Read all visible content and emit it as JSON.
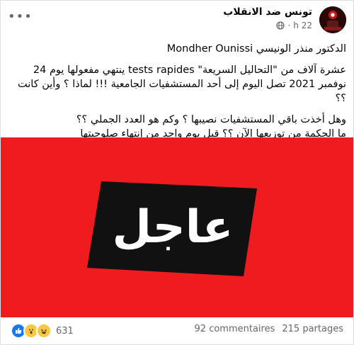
{
  "header": {
    "page_name": "تونس ضد الانقلاب",
    "time": "22 h",
    "separator": "·"
  },
  "post": {
    "author_line": "الدكتور منذر الونيسي Mondher Ounissi",
    "para1_line1": "عشرة آلاف من \"التحاليل السريعة\" tests rapides ينتهي مفعولها يوم 24",
    "para1_line2": "نوفمبر 2021 تصل اليوم إلى أحد المستشفيات الجامعية !!! لماذا ؟ وأين كانت",
    "para1_line3": "؟؟",
    "para2_line1": "وهل أخذت باقي المستشفيات نصيبها ؟ وكم هو العدد الجملي ؟؟",
    "para2_line2": "ما الحكمة من توزيعها الآن ؟؟ قبل يوم واحد من إنتهاء صلوحيتها"
  },
  "banner": {
    "text": "عاجل",
    "colors": {
      "background": "#ef1b1f",
      "label": "#111111",
      "text": "#ffffff"
    }
  },
  "footer": {
    "reaction_count": "631",
    "comments": "92 commentaires",
    "shares": "215 partages"
  }
}
